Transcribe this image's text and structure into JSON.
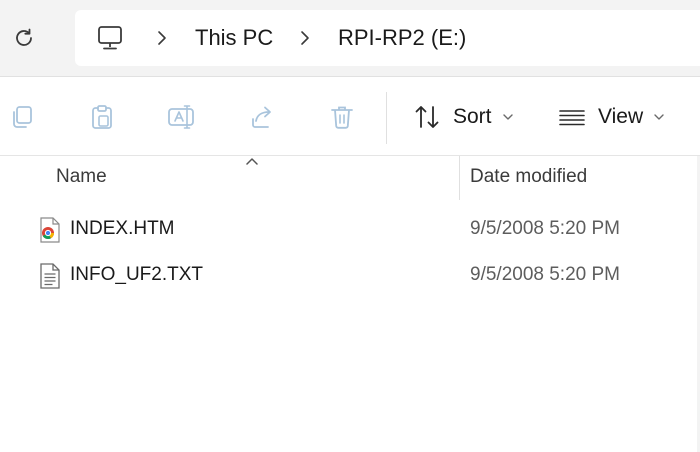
{
  "address": {
    "breadcrumbs": [
      "This PC",
      "RPI-RP2 (E:)"
    ],
    "icons": {
      "refresh": "refresh-icon",
      "location": "computer-icon",
      "separator": "chevron-right-icon"
    }
  },
  "toolbar": {
    "icons": [
      "copy-icon",
      "paste-icon",
      "rename-icon",
      "share-icon",
      "delete-icon"
    ],
    "sort_label": "Sort",
    "view_label": "View"
  },
  "columns": {
    "name": "Name",
    "date_modified": "Date modified"
  },
  "files": [
    {
      "name": "INDEX.HTM",
      "date_modified": "9/5/2008 5:20 PM",
      "icon": "chrome-html-file-icon"
    },
    {
      "name": "INFO_UF2.TXT",
      "date_modified": "9/5/2008 5:20 PM",
      "icon": "text-file-icon"
    }
  ],
  "colors": {
    "chrome_bg": "#f3f3f3",
    "content_bg": "#ffffff",
    "disabled_icon": "#a9c4dc",
    "text": "#1a1a1a"
  }
}
